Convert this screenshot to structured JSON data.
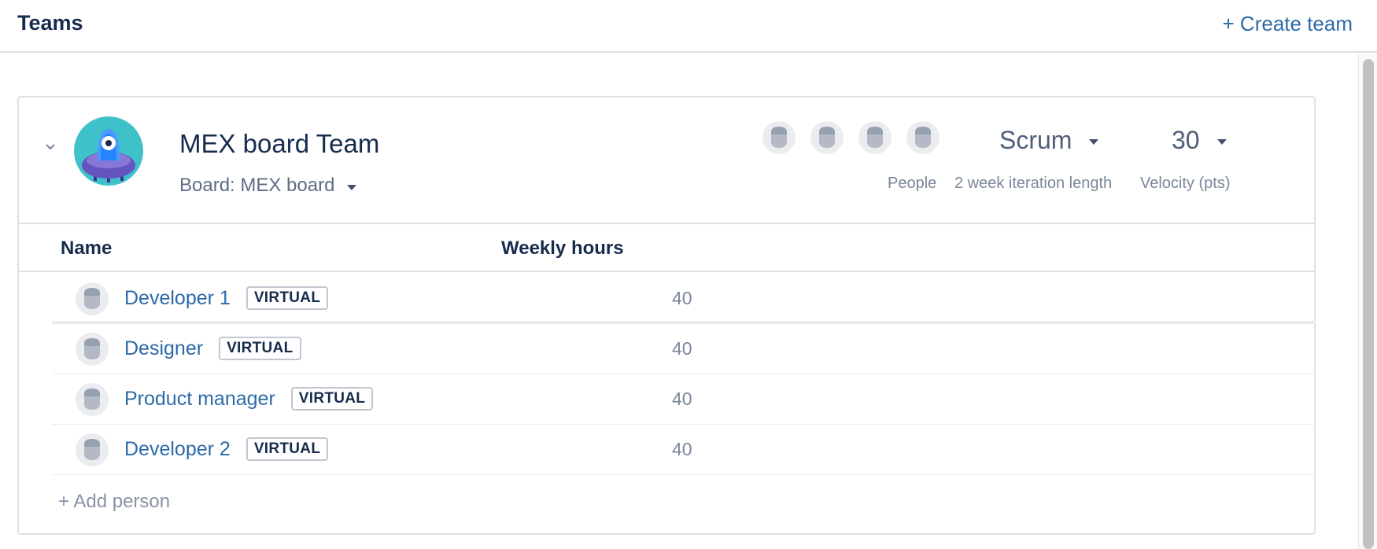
{
  "header": {
    "title": "Teams",
    "create_team_label": "+ Create team"
  },
  "team": {
    "name": "MEX board Team",
    "board_label": "Board: MEX board",
    "people_label": "People",
    "iteration_label": "2 week iteration length",
    "velocity_label": "Velocity (pts)",
    "methodology": "Scrum",
    "velocity": "30",
    "people_count": 4
  },
  "table": {
    "columns": {
      "name": "Name",
      "weekly_hours": "Weekly hours"
    },
    "rows": [
      {
        "name": "Developer 1",
        "badge": "VIRTUAL",
        "hours": "40"
      },
      {
        "name": "Designer",
        "badge": "VIRTUAL",
        "hours": "40"
      },
      {
        "name": "Product manager",
        "badge": "VIRTUAL",
        "hours": "40"
      },
      {
        "name": "Developer 2",
        "badge": "VIRTUAL",
        "hours": "40"
      }
    ],
    "add_person_label": "+ Add person"
  },
  "colors": {
    "link": "#2d6aa8",
    "avatar_teal": "#3fc1c9",
    "avatar_purple": "#6554c0",
    "border": "#dfe1e6"
  }
}
